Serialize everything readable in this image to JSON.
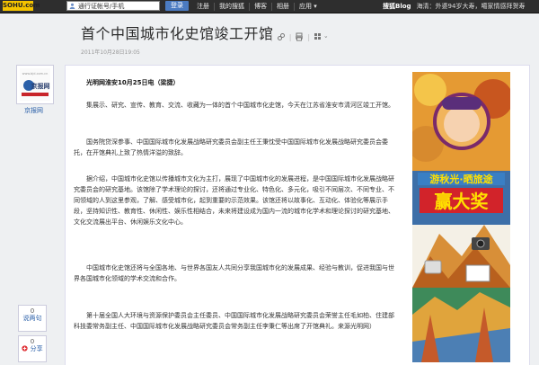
{
  "topbar": {
    "logo": "SOHU.com",
    "search_placeholder": "通行证帐号/手机",
    "login_label": "登录",
    "nav": [
      "注册",
      "我的搜狐",
      "博客",
      "相册",
      "应用"
    ],
    "nav_more": "▾",
    "brand": "搜狐Blog",
    "news": "海清：外婆94岁大寿，噶家情感拜贺寿"
  },
  "article": {
    "title": "首个中国城市化史馆竣工开馆",
    "date": "2011年10月28日19:05",
    "dateline": "光明网淮安10月25日电（梁捷）",
    "paragraphs": [
      "集展示、研究、宣传、教育、交流、收藏为一体的首个中国城市化史馆，今天在江苏省淮安市清河区竣工开馆。",
      "国务院贷深参事、中国国际城市化发展战略研究委员会副主任王秉忱受中国国际城市化发展战略研究委员会委托，在开馆典礼上致了热情洋溢的致辞。",
      "据介绍，中国城市化史馆以传播城市文化为主打，展现了中国城市化的发展进程，是中国国际城市化发展战略研究委员会的研究基地。该馆除了学术理论的探讨，还将通过专业化、特色化、多元化，吸引不同层次、不同专业、不同领域的人到这里参观，了解、感受城市化，起到重要的示范效果。该馆还将以故事化、互动化、体验化等展示手段，坚持知识性、教育性、休闲性、娱乐性相结合，未来将建设成为国内一流的城市化学术和理论探讨的研究基地、文化交流展出平台、休闲娱乐文化中心。",
      "中国城市化史馆还将与全国各地、与世界各国友人共同分享我国城市化的发展成果、经验与教训，促进我国与世界各国城市化领域的学术交流和合作。",
      "第十届全国人大环境与资源保护委员会主任委员、中国国际城市化发展战略研究委员会荣誉主任毛如柏、住建部科技委常务副主任、中国国际城市化发展战略研究委员会常务副主任李秉仁等出席了开馆典礼。来源光明网）"
    ]
  },
  "author": {
    "name": "京报网",
    "avatar_text": "京报网",
    "avatar_url": "www.bjd.com.cn"
  },
  "actions": {
    "comment_count": "0",
    "comment_label": "说两句",
    "share_count": "0",
    "share_label": "分享"
  },
  "ad": {
    "line1": "游秋光·晒旅途",
    "line2": "赢大奖"
  },
  "colors": {
    "topbar_bg": "#2e2e2e",
    "link_blue": "#2a5fa8",
    "ad_red": "#d2232a",
    "ad_yellow": "#ffe000"
  }
}
